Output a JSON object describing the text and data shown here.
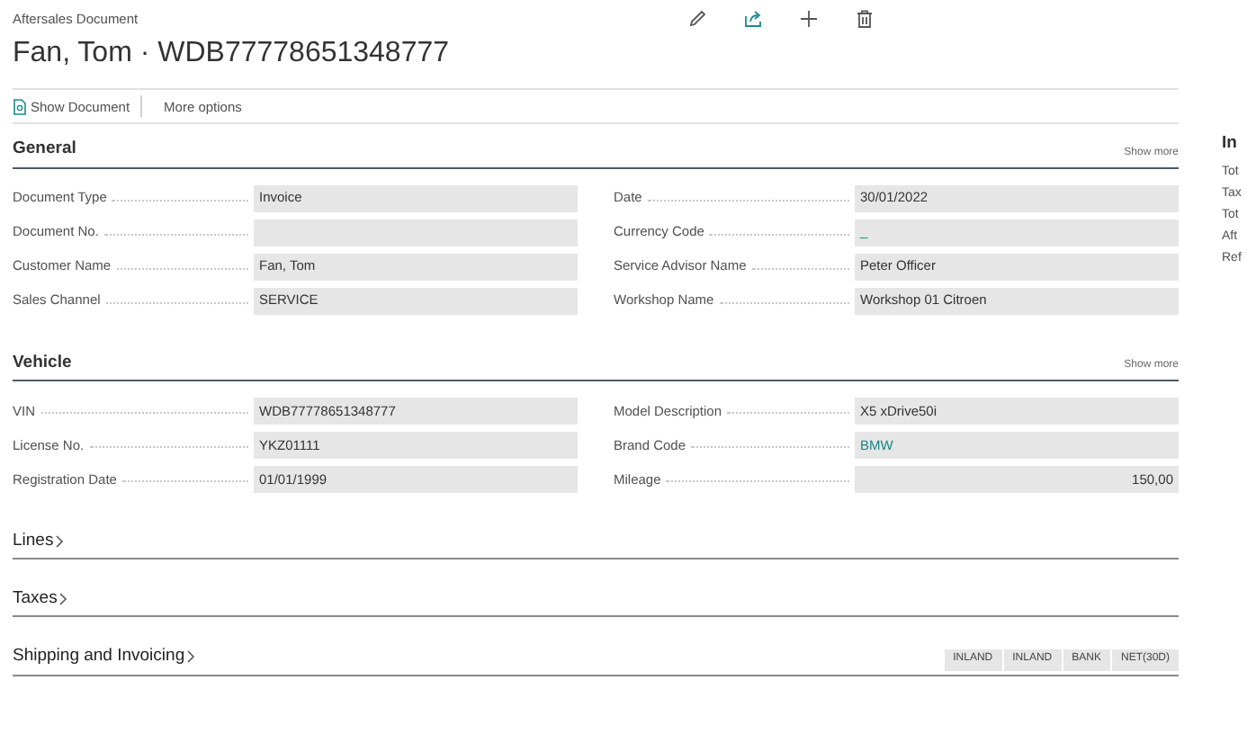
{
  "header": {
    "caption": "Aftersales Document",
    "title": "Fan, Tom · WDB77778651348777"
  },
  "actions": [
    {
      "kind": "show-document",
      "label": "Show Document"
    },
    {
      "kind": "more",
      "label": "More options"
    }
  ],
  "sections": [
    {
      "title": "General",
      "expanded": true,
      "show_more": "Show more",
      "left": [
        {
          "label": "Document Type",
          "value": "Invoice",
          "kind": "text"
        },
        {
          "label": "Document No.",
          "kind": "text"
        },
        {
          "label": "Customer Name",
          "value": "Fan, Tom",
          "kind": "text"
        },
        {
          "label": "Sales Channel",
          "value": "SERVICE",
          "kind": "text"
        }
      ],
      "right": [
        {
          "label": "Date",
          "value": "30/01/2022",
          "kind": "text"
        },
        {
          "label": "Currency Code",
          "value": "_",
          "kind": "link"
        },
        {
          "label": "Service Advisor Name",
          "value": "Peter Officer",
          "kind": "text"
        },
        {
          "label": "Workshop Name",
          "value": "Workshop 01 Citroen",
          "kind": "text"
        }
      ]
    },
    {
      "title": "Vehicle",
      "expanded": true,
      "show_more": "Show more",
      "left": [
        {
          "label": "VIN",
          "value": "WDB77778651348777",
          "kind": "text"
        },
        {
          "label": "License No.",
          "value": "YKZ01111",
          "kind": "text"
        },
        {
          "label": "Registration Date",
          "value": "01/01/1999",
          "kind": "text"
        }
      ],
      "right": [
        {
          "label": "Model Description",
          "value": "X5 xDrive50i",
          "kind": "text"
        },
        {
          "label": "Brand Code",
          "value": "BMW",
          "kind": "link"
        },
        {
          "label": "Mileage",
          "value": "150,00",
          "kind": "number"
        }
      ]
    },
    {
      "title": "Lines",
      "expanded": false
    },
    {
      "title": "Taxes",
      "expanded": false
    },
    {
      "title": "Shipping and Invoicing",
      "expanded": false,
      "summary": [
        "INLAND",
        "INLAND",
        "BANK",
        "NET(30D)"
      ]
    }
  ],
  "factbox": {
    "title": "In",
    "items": [
      "Tot",
      "Tax",
      "Tot",
      "Aft",
      "Ref"
    ]
  }
}
